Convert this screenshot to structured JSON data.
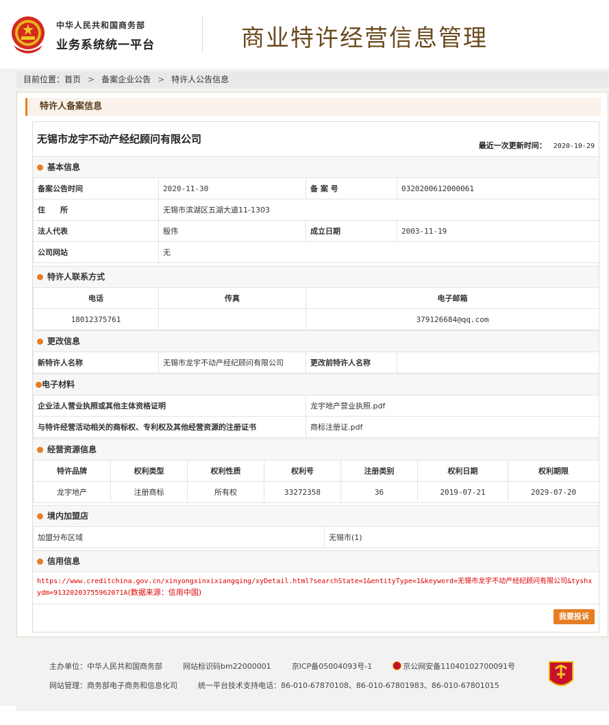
{
  "header": {
    "org_line1": "中华人民共和国商务部",
    "org_line2": "业务系统统一平台",
    "system_title": "商业特许经营信息管理"
  },
  "breadcrumb": {
    "prefix": "目前位置：",
    "items": [
      "首页",
      "备案企业公告",
      "特许人公告信息"
    ],
    "separator": ">"
  },
  "panel_title": "特许人备案信息",
  "company": {
    "name": "无锡市龙宇不动产经纪顾问有限公司",
    "updated_label": "最近一次更新时间：",
    "updated_value": "2020-10-29"
  },
  "basic": {
    "title": "基本信息",
    "filing_date_label": "备案公告时间",
    "filing_date": "2020-11-30",
    "filing_no_label": "备 案 号",
    "filing_no": "0320200612000061",
    "address_label": "住　　所",
    "address": "无锡市滨湖区五湖大道11-1303",
    "legal_rep_label": "法人代表",
    "legal_rep": "殷伟",
    "founded_label": "成立日期",
    "founded": "2003-11-19",
    "website_label": "公司网站",
    "website": "无"
  },
  "contact": {
    "title": "特许人联系方式",
    "headers": [
      "电话",
      "传真",
      "电子邮箱"
    ],
    "phone": "18012375761",
    "fax": "",
    "email": "379126684@qq.com"
  },
  "changes": {
    "title": "更改信息",
    "new_name_label": "新特许人名称",
    "new_name": "无锡市龙宇不动产经纪顾问有限公司",
    "old_name_label": "更改前特许人名称",
    "old_name": ""
  },
  "materials": {
    "title": "电子材料",
    "row1_label": "企业法人营业执照或其他主体资格证明",
    "row1_file": "龙宇地产营业执照.pdf",
    "row2_label": "与特许经营活动相关的商标权、专利权及其他经营资源的注册证书",
    "row2_file": "商标注册证.pdf"
  },
  "resources": {
    "title": "经营资源信息",
    "headers": [
      "特许品牌",
      "权利类型",
      "权利性质",
      "权利号",
      "注册类别",
      "权利日期",
      "权利期限"
    ],
    "rows": [
      [
        "龙宇地产",
        "注册商标",
        "所有权",
        "33272358",
        "36",
        "2019-07-21",
        "2029-07-20"
      ]
    ]
  },
  "franchise": {
    "title": "境内加盟店",
    "region_label": "加盟分布区域",
    "region_value": "无锡市(1)"
  },
  "credit": {
    "title": "信用信息",
    "url": "https://www.creditchina.gov.cn/xinyongxinxixiangqing/xyDetail.html?searchState=1&entityType=1&keyword=无锡市龙宇不动产经纪顾问有限公司&tyshxydm=91320203755962071A",
    "source_note": "(数据来源：信用中国)"
  },
  "complain_button": "我要投诉",
  "footer": {
    "sponsor": "主办单位：中华人民共和国商务部",
    "site_id": "网站标识码bm22000001",
    "icp": "京ICP备05004093号-1",
    "police": "京公网安备11040102700091号",
    "manager": "网站管理：商务部电子商务和信息化司",
    "support": "统一平台技术支持电话：86-010-67870108、86-010-67801983、86-010-67801015"
  },
  "colors": {
    "accent": "#e67e22",
    "title_brown": "#6b4a1e",
    "link_red": "#dd0000"
  }
}
